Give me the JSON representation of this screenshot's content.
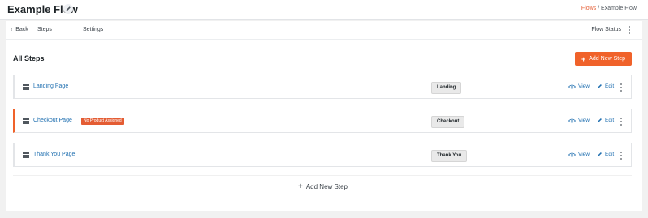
{
  "header": {
    "title": "Example Flow",
    "breadcrumb_link": "Flows",
    "breadcrumb_sep": " / ",
    "breadcrumb_current": "Example Flow"
  },
  "nav": {
    "back": "Back",
    "steps": "Steps",
    "settings": "Settings",
    "flow_status": "Flow Status"
  },
  "main": {
    "heading": "All Steps",
    "add_new_step": "Add New Step",
    "add_new_step_bottom": "Add New Step"
  },
  "steps": [
    {
      "title": "Landing Page",
      "badge": "",
      "type": "Landing",
      "view": "View",
      "edit": "Edit"
    },
    {
      "title": "Checkout Page",
      "badge": "No Product Assigned",
      "type": "Checkout",
      "view": "View",
      "edit": "Edit"
    },
    {
      "title": "Thank You Page",
      "badge": "",
      "type": "Thank You",
      "view": "View",
      "edit": "Edit"
    }
  ],
  "colors": {
    "accent": "#f0622a",
    "link": "#2271b1"
  }
}
